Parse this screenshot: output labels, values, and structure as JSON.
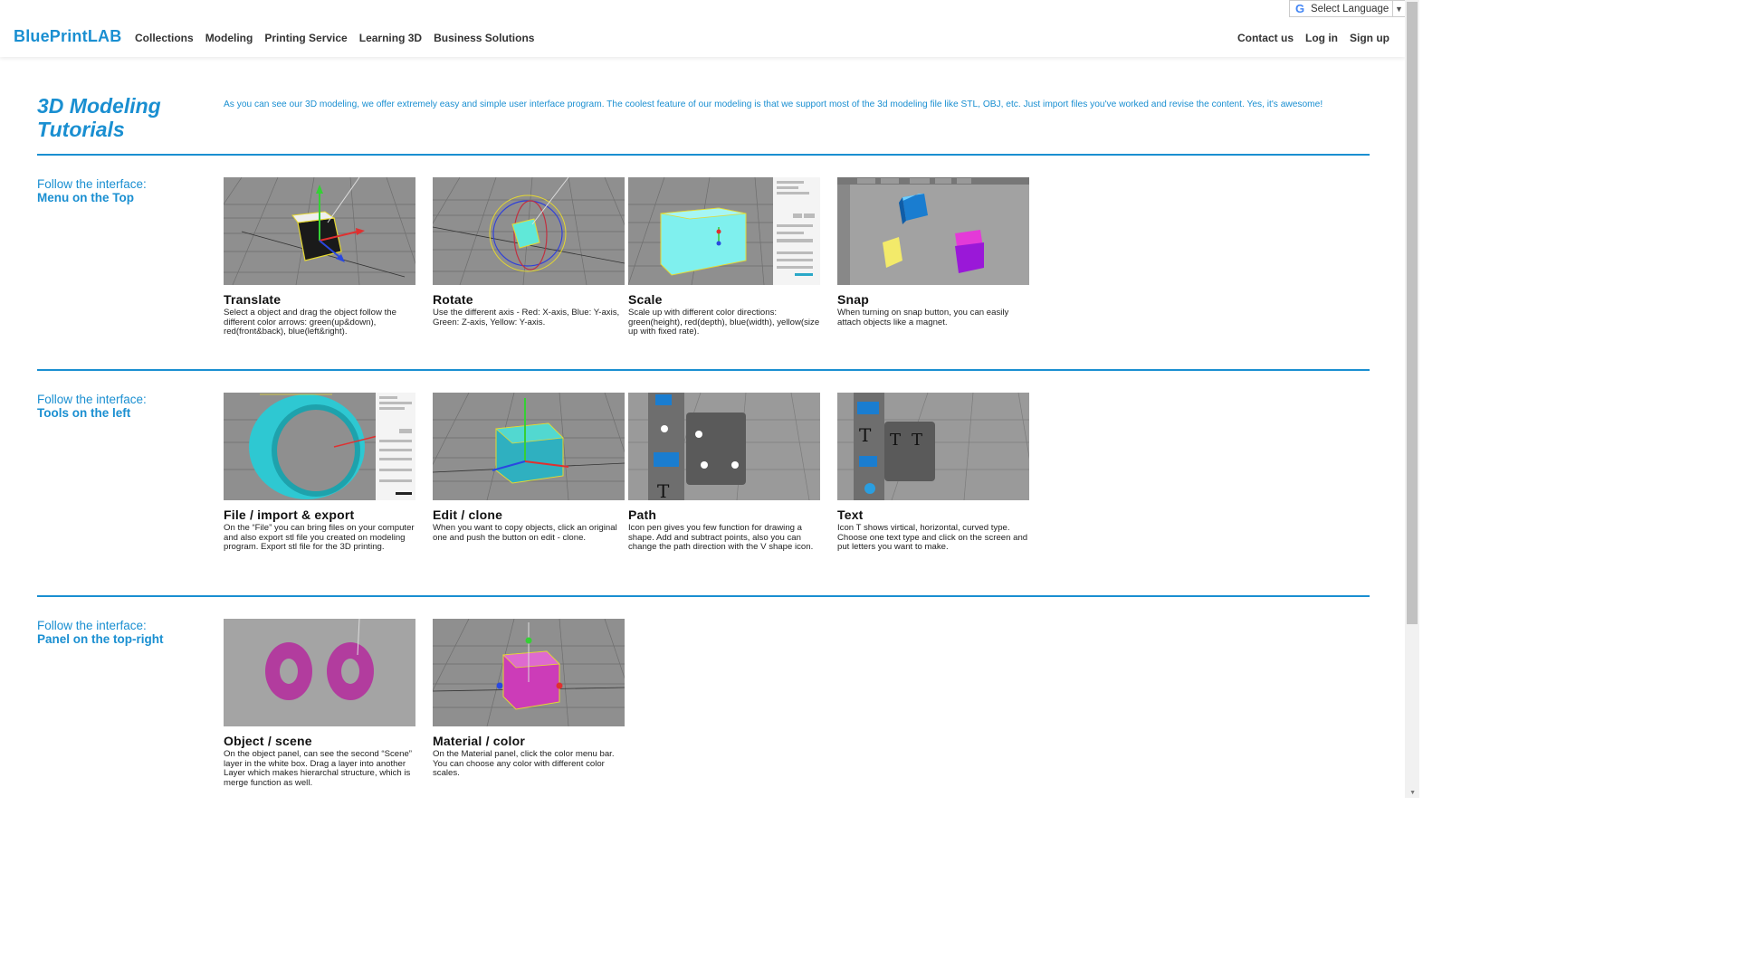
{
  "header": {
    "logo": {
      "part1": "BluePrint",
      "part2": "LAB"
    },
    "nav_left": [
      "Collections",
      "Modeling",
      "Printing Service",
      "Learning 3D",
      "Business Solutions"
    ],
    "nav_right": [
      "Contact us",
      "Log in",
      "Sign up"
    ],
    "language": {
      "g_icon": "G",
      "label": "Select Language"
    }
  },
  "intro": {
    "title": "3D Modeling Tutorials",
    "text": "As you can see our 3D modeling, we offer extremely easy and simple user interface program. The coolest feature of our modeling is that we support most of the 3d modeling file like STL, OBJ, etc. Just import files you've worked and revise the content. Yes, it's awesome!"
  },
  "sections": [
    {
      "label_prefix": "Follow the interface:",
      "label_name": "Menu on the Top",
      "cards": [
        {
          "title": "Translate",
          "desc": "Select a object and drag the object follow the different color arrows: green(up&down), red(front&back), blue(left&right).",
          "icon": "translate-thumbnail"
        },
        {
          "title": "Rotate",
          "desc": "Use the different axis - Red: X-axis, Blue: Y-axis, Green: Z-axis, Yellow: Y-axis.",
          "icon": "rotate-thumbnail"
        },
        {
          "title": "Scale",
          "desc": "Scale up with different color directions: green(height), red(depth), blue(width), yellow(size up with fixed rate).",
          "icon": "scale-thumbnail"
        },
        {
          "title": "Snap",
          "desc": "When turning on snap button, you can easily attach objects like a magnet.",
          "icon": "snap-thumbnail"
        }
      ]
    },
    {
      "label_prefix": "Follow the interface:",
      "label_name": "Tools on the left",
      "cards": [
        {
          "title": "File / import & export",
          "desc": "On the “File” you can bring files on your computer and also export stl file you created on modeling program. Export stl file for the 3D printing.",
          "icon": "ring-thumbnail"
        },
        {
          "title": "Edit / clone",
          "desc": "When you want to copy objects, click an original one and push the button on edit - clone.",
          "icon": "clone-thumbnail"
        },
        {
          "title": "Path",
          "desc": "Icon pen gives you few function for drawing a shape. Add and subtract points, also you can change the path direction with the V shape icon.",
          "icon": "path-thumbnail"
        },
        {
          "title": "Text",
          "desc": "Icon T shows virtical, horizontal, curved type. Choose one text type and click on the screen and put letters you want to make.",
          "icon": "text-thumbnail"
        }
      ]
    },
    {
      "label_prefix": "Follow the interface:",
      "label_name": "Panel on the top-right",
      "cards": [
        {
          "title": "Object / scene",
          "desc": "On the object panel, can see the second “Scene” layer in the white box. Drag a layer into another Layer which makes hierarchal structure, which is merge function as well.",
          "icon": "torus-thumbnail"
        },
        {
          "title": "Material / color",
          "desc": "On the Material panel, click the color menu bar. You can choose any color with different color scales.",
          "icon": "material-thumbnail"
        }
      ]
    }
  ]
}
